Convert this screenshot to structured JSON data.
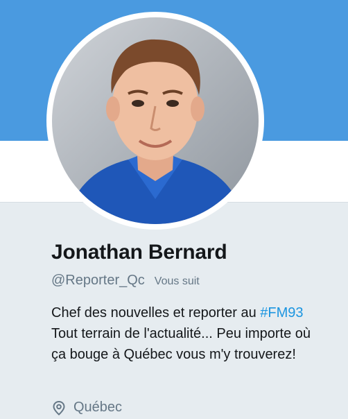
{
  "colors": {
    "banner": "#4a9ae0",
    "background": "#e6ecf0",
    "hashtag": "#1b95e0",
    "muted": "#657786",
    "text": "#14171a"
  },
  "profile": {
    "name": "Jonathan Bernard",
    "handle": "@Reporter_Qc",
    "follows_you": "Vous suit",
    "bio_before": "Chef des nouvelles et reporter au ",
    "bio_hashtag": "#FM93",
    "bio_after": " Tout terrain de l'actualité... Peu importe où ça bouge à Québec vous m'y trouverez!",
    "location": "Québec",
    "location_icon": "location-pin-icon",
    "avatar_icon": "avatar-photo"
  }
}
